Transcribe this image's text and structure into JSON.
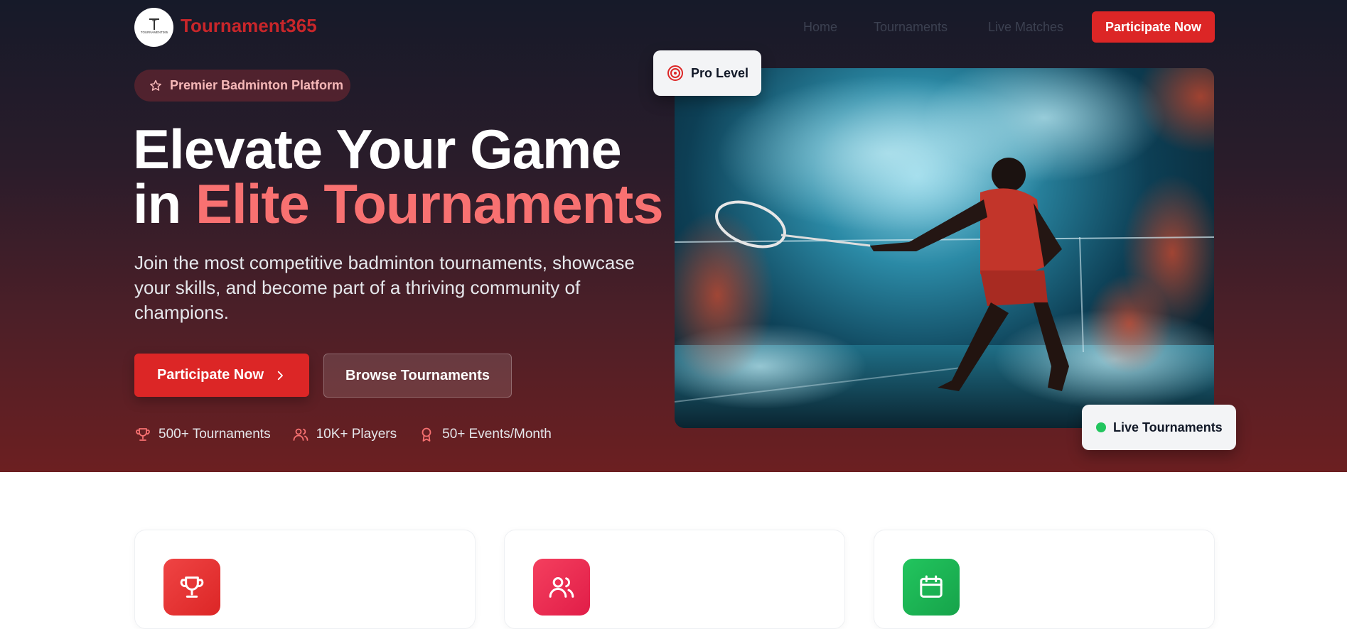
{
  "brand": {
    "name": "Tournament365",
    "logo_text": "TOURNAMENT365"
  },
  "nav": {
    "links": [
      "Home",
      "Tournaments",
      "Live Matches"
    ],
    "cta": "Participate Now"
  },
  "hero": {
    "badge": "Premier Badminton Platform",
    "title_line1": "Elevate Your Game",
    "title_line2_prefix": "in ",
    "title_line2_accent": "Elite Tournaments",
    "subtitle": "Join the most competitive badminton tournaments, showcase your skills, and become part of a thriving community of champions.",
    "primary_button": "Participate Now",
    "secondary_button": "Browse Tournaments",
    "stats": [
      {
        "icon": "trophy-icon",
        "label": "500+ Tournaments"
      },
      {
        "icon": "users-icon",
        "label": "10K+ Players"
      },
      {
        "icon": "award-icon",
        "label": "50+ Events/Month"
      }
    ],
    "image_badges": {
      "top": "Pro Level",
      "bottom": "Live Tournaments"
    }
  },
  "features": [
    {
      "icon": "trophy-icon",
      "color": "#e53e3e"
    },
    {
      "icon": "users-icon",
      "color": "#e11d48"
    },
    {
      "icon": "calendar-icon",
      "color": "#16a34a"
    }
  ],
  "colors": {
    "accent": "#dc2626",
    "accent_text": "#f87171",
    "live_dot": "#22c55e"
  }
}
